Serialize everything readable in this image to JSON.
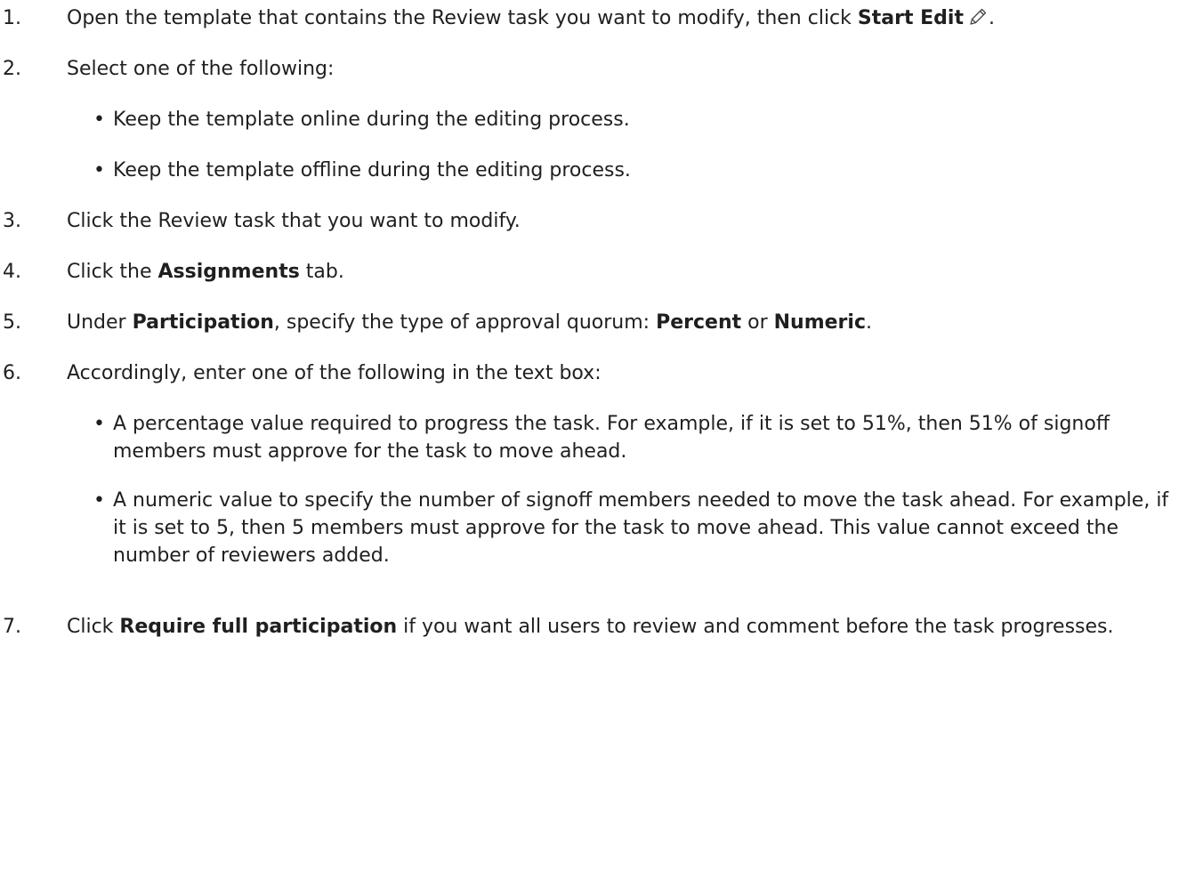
{
  "steps": [
    {
      "num": "1.",
      "parts": [
        "Open the template that contains the Review task you want to modify, then click ",
        "Start Edit",
        "."
      ]
    },
    {
      "num": "2.",
      "text": "Select one of the following:",
      "bullets": [
        "Keep the template online during the editing process.",
        "Keep the template offline during the editing process."
      ]
    },
    {
      "num": "3.",
      "text": "Click the Review task that you want to modify."
    },
    {
      "num": "4.",
      "parts": [
        "Click the ",
        "Assignments",
        " tab."
      ]
    },
    {
      "num": "5.",
      "parts": [
        "Under ",
        "Participation",
        ", specify the type of approval quorum: ",
        "Percent",
        " or ",
        "Numeric",
        "."
      ]
    },
    {
      "num": "6.",
      "text": "Accordingly, enter one of the following in the text box:",
      "bullets": [
        "A percentage value required to progress the task. For example, if it is set to 51%, then 51% of signoff members must approve for the task to move ahead.",
        "A numeric value to specify the number of signoff members needed to move the task ahead. For example, if it is set to 5, then 5 members must approve for the task to move ahead. This value cannot exceed the number of reviewers added."
      ]
    },
    {
      "num": "7.",
      "parts": [
        "Click ",
        "Require full participation",
        " if you want all users to review and comment before the task progresses."
      ]
    }
  ],
  "bullet_glyph": "•",
  "icons": {
    "start_edit": "pencil-icon"
  }
}
